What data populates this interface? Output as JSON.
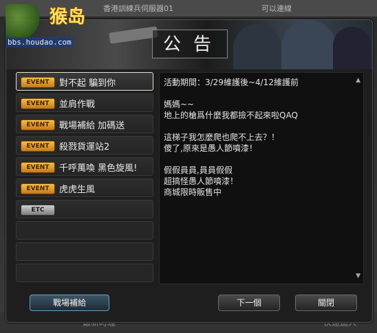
{
  "background": {
    "topbar": {
      "left_text": "香港訓練兵伺服器01",
      "right_text": "可以連線"
    },
    "bottom": {
      "left_text": "最新時理",
      "right_text": "快速進入"
    }
  },
  "watermark": {
    "name": "猴岛",
    "url": "bbs.houdao.com"
  },
  "modal": {
    "title": "公告",
    "events": [
      {
        "badge": "EVENT",
        "label": "對不起 騙到你",
        "selected": true
      },
      {
        "badge": "EVENT",
        "label": "並肩作戰"
      },
      {
        "badge": "EVENT",
        "label": "戰場補給 加碼送"
      },
      {
        "badge": "EVENT",
        "label": "殺戮貨運站2"
      },
      {
        "badge": "EVENT",
        "label": "千呼萬喚 黑色旋風!"
      },
      {
        "badge": "EVENT",
        "label": "虎虎生風"
      },
      {
        "badge": "ETC",
        "label": ""
      }
    ],
    "content_text": "活動期間：3/29維護後~4/12維護前\n\n媽媽~~\n地上的槍爲什麼我都撿不起來啦QAQ\n\n這梯子我怎麼爬也爬不上去？！\n傻了,原來是愚人節噴漆！\n\n假假員員,員員假假\n超搞怪愚人節噴漆！\n商城限時販售中",
    "buttons": {
      "supply": "戰場補給",
      "next": "下一個",
      "close": "關閉"
    }
  },
  "colors": {
    "event_badge": "#f2c04a",
    "accent_border": "#6aa2c8"
  }
}
